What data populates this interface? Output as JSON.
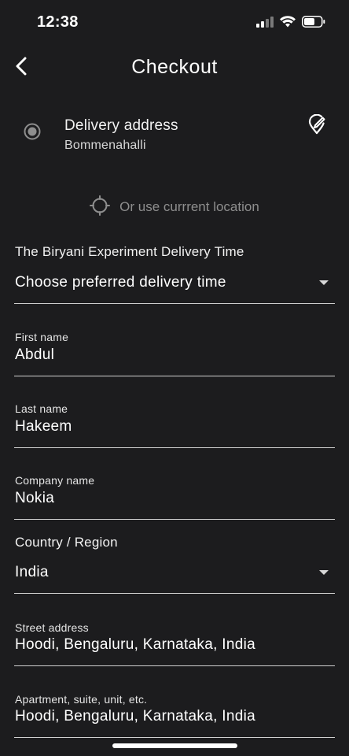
{
  "status_bar": {
    "time": "12:38"
  },
  "header": {
    "title": "Checkout",
    "back_icon": "chevron-left-icon"
  },
  "delivery": {
    "title": "Delivery address",
    "address": "Bommenahalli",
    "radio_icon": "radio-selected-icon",
    "edit_icon": "location-edit-icon"
  },
  "current_location": {
    "label": "Or use currrent location",
    "icon": "crosshair-icon"
  },
  "delivery_time": {
    "label": "The Biryani Experiment Delivery Time",
    "value": "Choose preferred delivery time"
  },
  "form": {
    "first_name": {
      "label": "First name",
      "value": "Abdul"
    },
    "last_name": {
      "label": "Last name",
      "value": "Hakeem"
    },
    "company_name": {
      "label": "Company name",
      "value": "Nokia"
    },
    "country": {
      "label": "Country / Region",
      "value": "India"
    },
    "street_address": {
      "label": "Street address",
      "value": "Hoodi, Bengaluru, Karnataka, India"
    },
    "apartment": {
      "label": "Apartment, suite, unit, etc.",
      "value": "Hoodi, Bengaluru, Karnataka, India"
    }
  },
  "colors": {
    "background": "#1c1c1e",
    "text": "#ffffff",
    "muted": "#8e8e8e",
    "divider": "#d0d0d0"
  }
}
